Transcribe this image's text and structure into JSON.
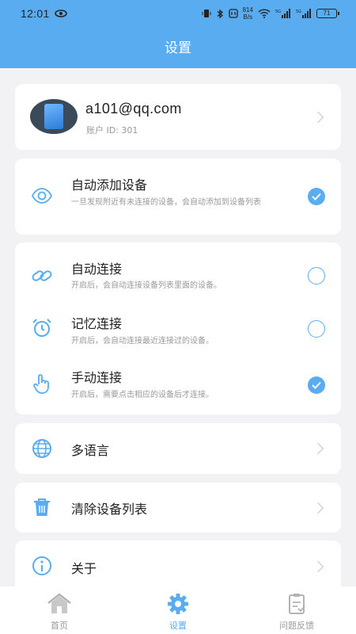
{
  "status_bar": {
    "time": "12:01",
    "net_speed_value": "814",
    "net_speed_unit": "B/s",
    "battery": "71"
  },
  "header": {
    "title": "设置"
  },
  "account": {
    "email": "a101@qq.com",
    "account_id": "账户 ID: 301"
  },
  "auto_add": {
    "title": "自动添加设备",
    "desc": "一旦发现附近有未连接的设备，会自动添加到设备列表",
    "checked": true
  },
  "connect_modes": [
    {
      "icon": "link-icon",
      "title": "自动连接",
      "desc": "开启后，会自动连接设备列表里面的设备。",
      "checked": false
    },
    {
      "icon": "alarm-clock-icon",
      "title": "记忆连接",
      "desc": "开启后，会自动连接最近连接过的设备。",
      "checked": false
    },
    {
      "icon": "hand-pointer-icon",
      "title": "手动连接",
      "desc": "开启后，需要点击相应的设备后才连接。",
      "checked": true
    }
  ],
  "menu": {
    "language": "多语言",
    "clear_devices": "清除设备列表",
    "about": "关于"
  },
  "tabs": [
    {
      "label": "首页",
      "icon": "home-icon",
      "active": false
    },
    {
      "label": "设置",
      "icon": "gear-icon",
      "active": true
    },
    {
      "label": "问题反馈",
      "icon": "feedback-icon",
      "active": false
    }
  ],
  "colors": {
    "accent": "#5aacf1",
    "background": "#f2f2f4",
    "text": "#222222",
    "muted": "#999999"
  }
}
